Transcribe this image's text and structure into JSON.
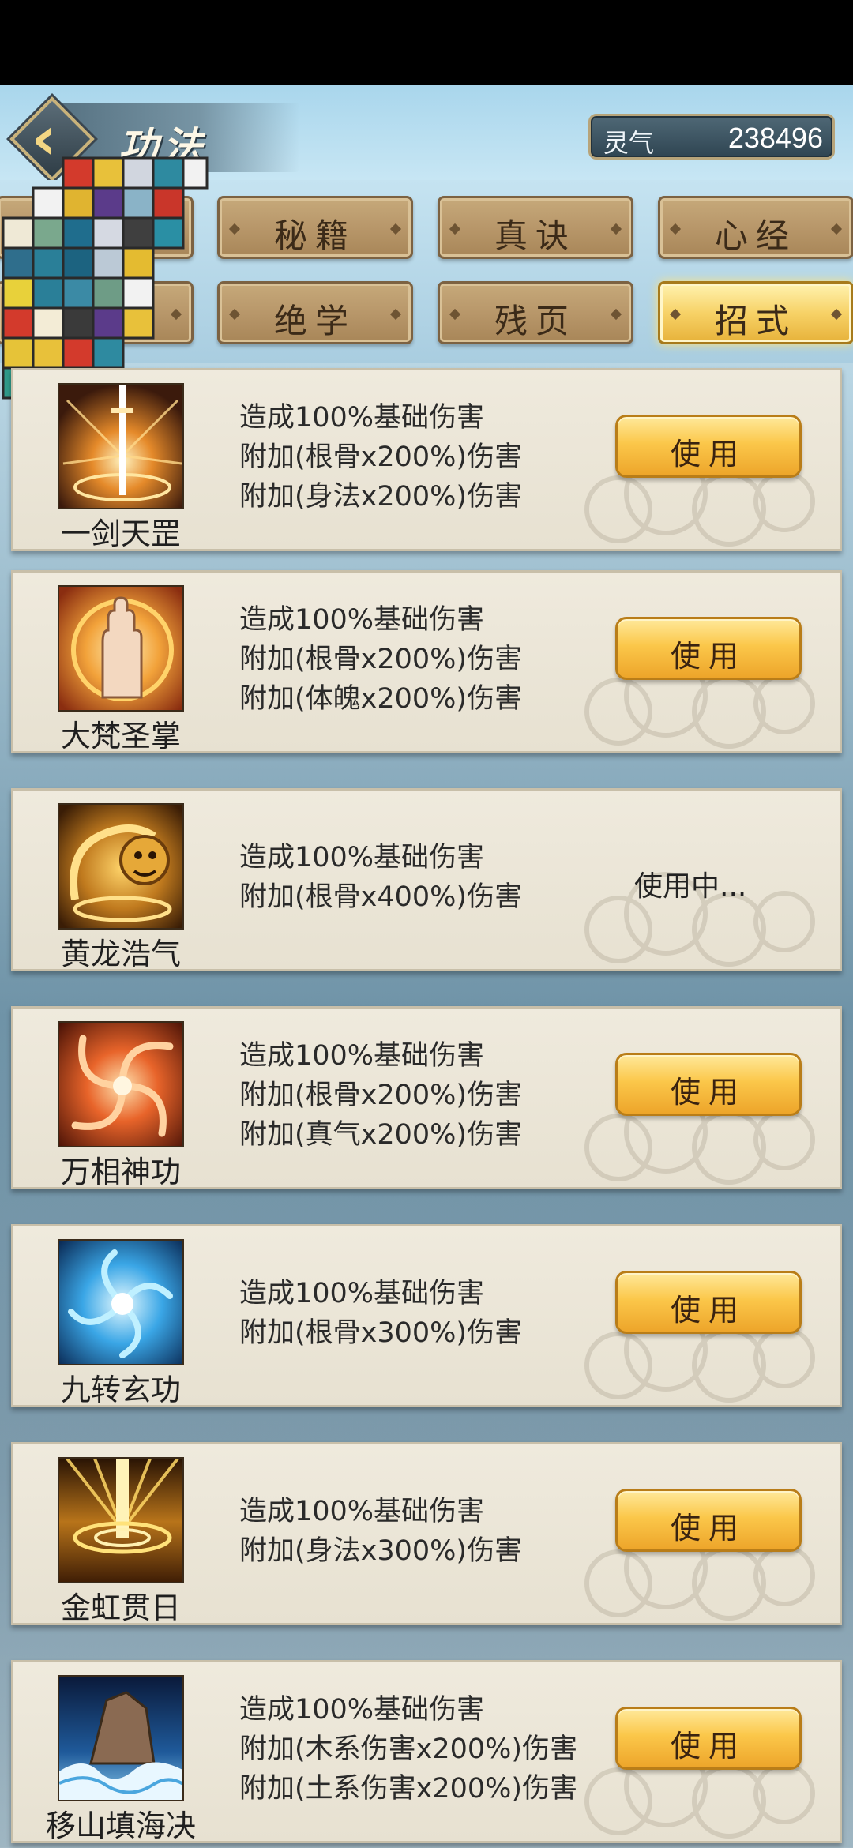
{
  "header": {
    "back_icon": "chevron-left-icon",
    "title": "功法",
    "currency_label": "灵气",
    "currency_value": "238496"
  },
  "tabs": [
    {
      "label": "秘籍",
      "active": false
    },
    {
      "label": "真诀",
      "active": false
    },
    {
      "label": "心经",
      "active": false
    },
    {
      "label": "绝学",
      "active": false
    },
    {
      "label": "残页",
      "active": false
    },
    {
      "label": "招式",
      "active": true
    }
  ],
  "skills": [
    {
      "name": "一剑天罡",
      "icon": "sword-light-icon",
      "lines": [
        "造成100%基础伤害",
        "附加(根骨x200%)伤害",
        "附加(身法x200%)伤害"
      ],
      "button": "使用"
    },
    {
      "name": "大梵圣掌",
      "icon": "palm-icon",
      "lines": [
        "造成100%基础伤害",
        "附加(根骨x200%)伤害",
        "附加(体魄x200%)伤害"
      ],
      "button": "使用"
    },
    {
      "name": "黄龙浩气",
      "icon": "dragon-icon",
      "lines": [
        "造成100%基础伤害",
        "附加(根骨x400%)伤害"
      ],
      "status": "使用中..."
    },
    {
      "name": "万相神功",
      "icon": "fire-swirl-icon",
      "lines": [
        "造成100%基础伤害",
        "附加(根骨x200%)伤害",
        "附加(真气x200%)伤害"
      ],
      "button": "使用"
    },
    {
      "name": "九转玄功",
      "icon": "blue-vortex-icon",
      "lines": [
        "造成100%基础伤害",
        "附加(根骨x300%)伤害"
      ],
      "button": "使用"
    },
    {
      "name": "金虹贯日",
      "icon": "golden-beam-icon",
      "lines": [
        "造成100%基础伤害",
        "附加(身法x300%)伤害"
      ],
      "button": "使用"
    },
    {
      "name": "移山填海决",
      "icon": "mountain-wave-icon",
      "lines": [
        "造成100%基础伤害",
        "附加(木系伤害x200%)伤害",
        "附加(土系伤害x200%)伤害"
      ],
      "button": "使用"
    }
  ],
  "colors": {
    "tab_active": "#f7d267",
    "button": "#fbc74a",
    "card": "#ece6d8"
  }
}
